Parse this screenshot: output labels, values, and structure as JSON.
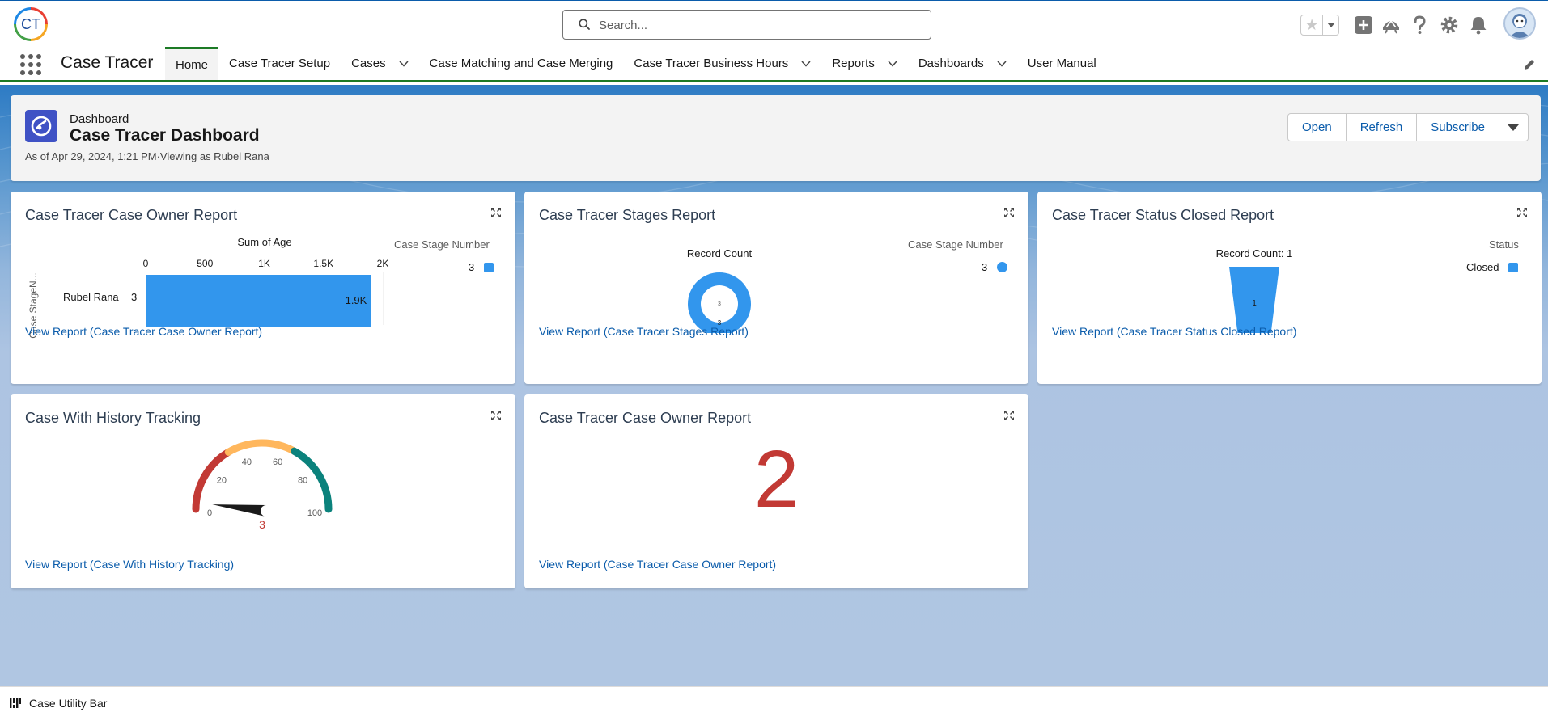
{
  "header": {
    "logo_text": "CT",
    "search_placeholder": "Search..."
  },
  "nav": {
    "app_name": "Case Tracer",
    "items": [
      {
        "label": "Home",
        "has_menu": false,
        "active": true
      },
      {
        "label": "Case Tracer Setup",
        "has_menu": false
      },
      {
        "label": "Cases",
        "has_menu": true
      },
      {
        "label": "Case Matching and Case Merging",
        "has_menu": false
      },
      {
        "label": "Case Tracer Business Hours",
        "has_menu": true
      },
      {
        "label": "Reports",
        "has_menu": true
      },
      {
        "label": "Dashboards",
        "has_menu": true
      },
      {
        "label": "User Manual",
        "has_menu": false
      }
    ]
  },
  "dashboard": {
    "type_label": "Dashboard",
    "title": "Case Tracer Dashboard",
    "subtitle": "As of Apr 29, 2024, 1:21 PM·Viewing as Rubel Rana",
    "buttons": {
      "open": "Open",
      "refresh": "Refresh",
      "subscribe": "Subscribe"
    }
  },
  "cards": {
    "owner_report": {
      "title": "Case Tracer Case Owner Report",
      "link": "View Report (Case Tracer Case Owner Report)",
      "axis_title": "Sum of Age",
      "y_axis_label": "Case StageN...",
      "legend_title": "Case Stage Number",
      "legend_value": "3",
      "row_label": "Rubel Rana",
      "row_group": "3",
      "bar_label": "1.9K"
    },
    "stages_report": {
      "title": "Case Tracer Stages Report",
      "link": "View Report (Case Tracer Stages Report)",
      "chart_title": "Record Count",
      "legend_title": "Case Stage Number",
      "legend_value": "3",
      "center_label": "3",
      "slice_label": "3"
    },
    "status_report": {
      "title": "Case Tracer Status Closed Report",
      "link": "View Report (Case Tracer Status Closed Report)",
      "chart_title": "Record Count: 1",
      "legend_title": "Status",
      "legend_value": "Closed",
      "funnel_label": "1"
    },
    "history_tracking": {
      "title": "Case With History Tracking",
      "link": "View Report (Case With History Tracking)",
      "value_label": "3"
    },
    "owner_metric": {
      "title": "Case Tracer Case Owner Report",
      "link": "View Report (Case Tracer Case Owner Report)",
      "value": "2"
    }
  },
  "utility_bar": {
    "label": "Case Utility Bar"
  },
  "colors": {
    "brand_blue": "#0b5cab",
    "chart_blue": "#3296ed",
    "nav_green": "#1c7a25",
    "metric_red": "#c23934",
    "gauge_red": "#c23934",
    "gauge_yellow": "#ffb75d",
    "gauge_teal": "#0b827c"
  },
  "chart_data": [
    {
      "type": "bar",
      "orientation": "horizontal",
      "title": "",
      "xlabel": "Sum of Age",
      "ylabel": "Case StageN...",
      "categories": [
        "Rubel Rana"
      ],
      "series": [
        {
          "name": "3",
          "values": [
            1900
          ]
        }
      ],
      "xlim": [
        0,
        2000
      ],
      "x_ticks": [
        "0",
        "500",
        "1K",
        "1.5K",
        "2K"
      ],
      "data_labels": [
        "1.9K"
      ],
      "legend": {
        "title": "Case Stage Number",
        "placement": "right"
      }
    },
    {
      "type": "pie",
      "variant": "donut",
      "title": "Record Count",
      "categories": [
        "3"
      ],
      "values": [
        3
      ],
      "legend": {
        "title": "Case Stage Number",
        "placement": "right"
      }
    },
    {
      "type": "funnel",
      "title": "Record Count: 1",
      "categories": [
        "Closed"
      ],
      "values": [
        1
      ],
      "legend": {
        "title": "Status",
        "placement": "right"
      }
    },
    {
      "type": "gauge",
      "value": 3,
      "range": [
        0,
        100
      ],
      "ticks": [
        "0",
        "20",
        "40",
        "60",
        "80",
        "100"
      ],
      "bands": [
        {
          "from": 0,
          "to": 33,
          "color": "#c23934"
        },
        {
          "from": 33,
          "to": 66,
          "color": "#ffb75d"
        },
        {
          "from": 66,
          "to": 100,
          "color": "#0b827c"
        }
      ]
    }
  ]
}
